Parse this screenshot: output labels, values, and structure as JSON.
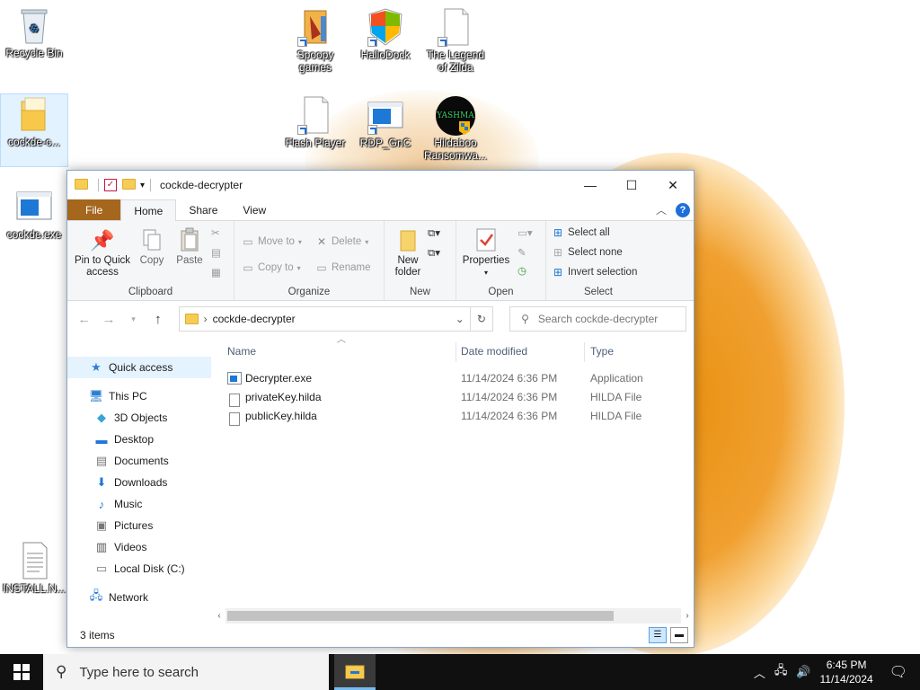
{
  "desktop": {
    "icons": [
      {
        "label": "Recycle Bin"
      },
      {
        "label": "cockde-c..."
      },
      {
        "label": "cockde.exe"
      },
      {
        "label": "Spoopy games"
      },
      {
        "label": "HalloDock"
      },
      {
        "label": "The Legend of Zilda"
      },
      {
        "label": "Flash Player"
      },
      {
        "label": "RDP_GnC"
      },
      {
        "label": "Hildaboo Ransomwa..."
      },
      {
        "label": "INSTALL.N..."
      }
    ],
    "yashma_text": "YASHMA"
  },
  "explorer": {
    "title": "cockde-decrypter",
    "controls": {
      "minimize": "—",
      "maximize": "☐",
      "close": "✕"
    },
    "tabs": {
      "file": "File",
      "home": "Home",
      "share": "Share",
      "view": "View"
    },
    "ribbon": {
      "pin_label_1": "Pin to Quick",
      "pin_label_2": "access",
      "copy": "Copy",
      "paste": "Paste",
      "clipboard_group": "Clipboard",
      "move_to": "Move to",
      "copy_to": "Copy to",
      "delete": "Delete",
      "rename": "Rename",
      "organize_group": "Organize",
      "new_folder_1": "New",
      "new_folder_2": "folder",
      "new_group": "New",
      "properties": "Properties",
      "open_group": "Open",
      "select_all": "Select all",
      "select_none": "Select none",
      "invert_selection": "Invert selection",
      "select_group": "Select"
    },
    "address": {
      "path": "cockde-decrypter",
      "search_placeholder": "Search cockde-decrypter"
    },
    "nav": {
      "quick_access": "Quick access",
      "this_pc": "This PC",
      "objects_3d": "3D Objects",
      "desktop": "Desktop",
      "documents": "Documents",
      "downloads": "Downloads",
      "music": "Music",
      "pictures": "Pictures",
      "videos": "Videos",
      "local_disk": "Local Disk (C:)",
      "network": "Network"
    },
    "columns": {
      "name": "Name",
      "date_modified": "Date modified",
      "type": "Type"
    },
    "files": [
      {
        "name": "Decrypter.exe",
        "date": "11/14/2024 6:36 PM",
        "type": "Application"
      },
      {
        "name": "privateKey.hilda",
        "date": "11/14/2024 6:36 PM",
        "type": "HILDA File"
      },
      {
        "name": "publicKey.hilda",
        "date": "11/14/2024 6:36 PM",
        "type": "HILDA File"
      }
    ],
    "status": "3 items"
  },
  "taskbar": {
    "search_placeholder": "Type here to search",
    "time": "6:45 PM",
    "date": "11/14/2024"
  }
}
